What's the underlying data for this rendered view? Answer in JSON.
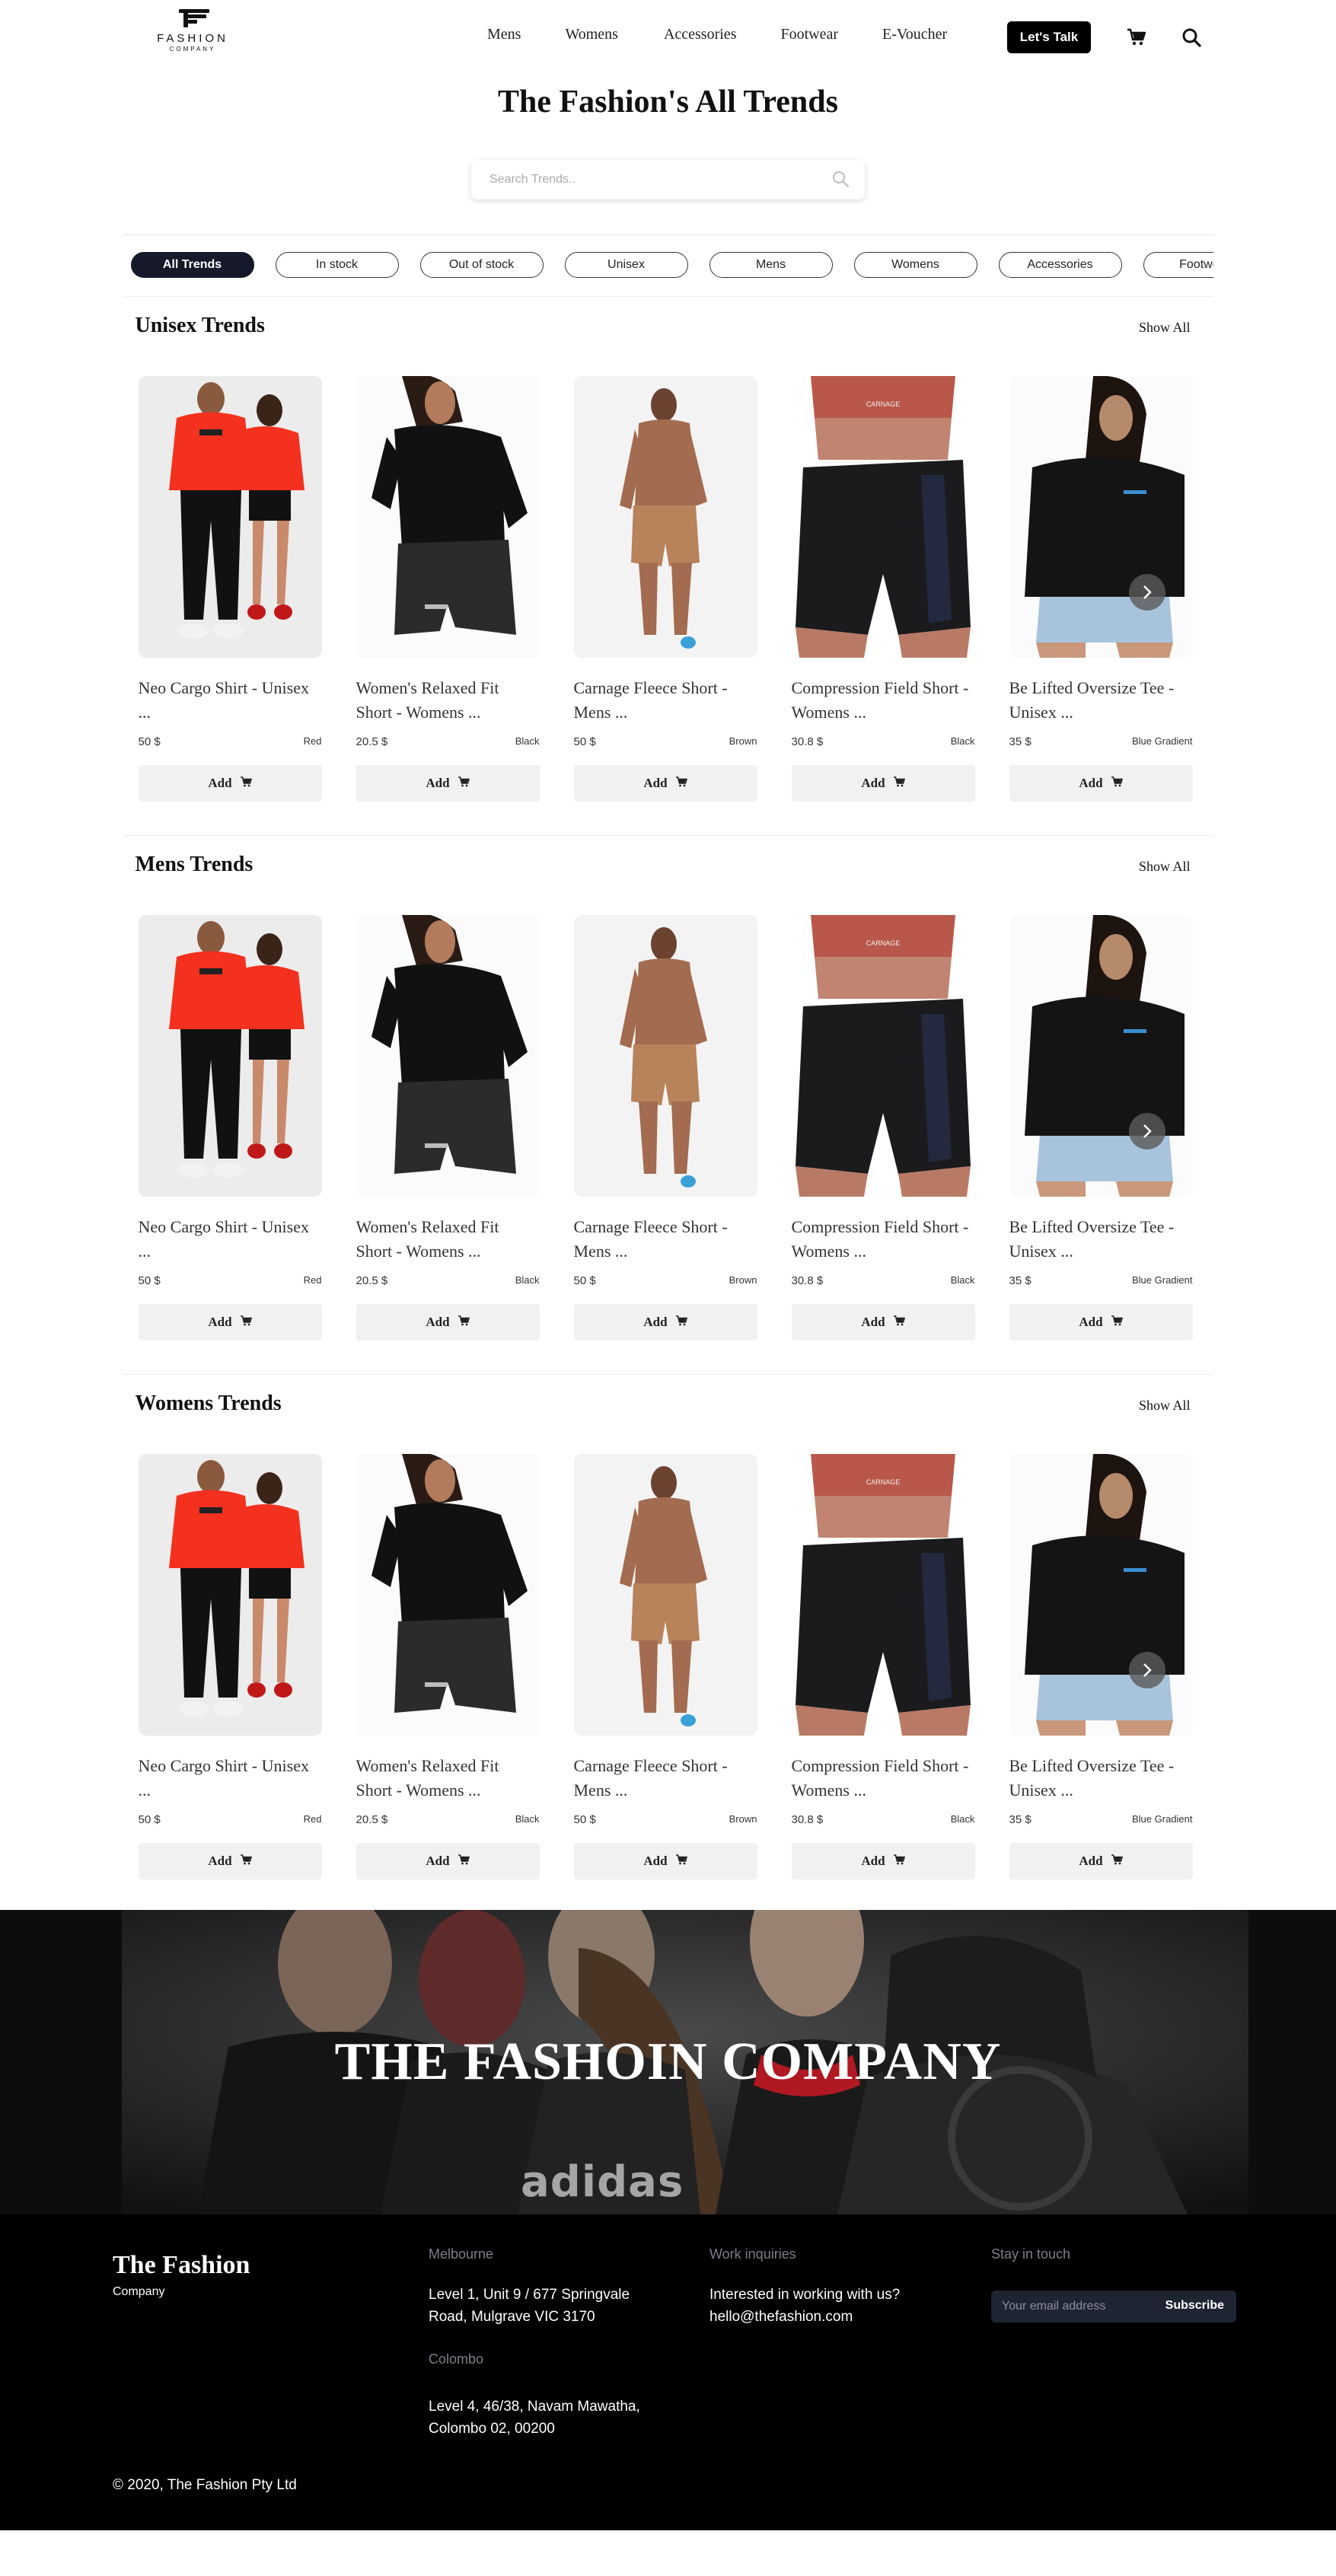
{
  "brand": {
    "logo_name": "FASHION",
    "logo_sub": "COMPANY"
  },
  "nav": [
    "Mens",
    "Womens",
    "Accessories",
    "Footwear",
    "E-Voucher"
  ],
  "header": {
    "cta": "Let's Talk",
    "cart_icon": "cart-icon",
    "search_icon": "search-icon"
  },
  "page_title": "The Fashion's All Trends",
  "search": {
    "placeholder": "Search Trends.."
  },
  "filters": [
    "All Trends",
    "In stock",
    "Out of stock",
    "Unisex",
    "Mens",
    "Womens",
    "Accessories",
    "Footwear"
  ],
  "active_filter": "All Trends",
  "sections": [
    {
      "title": "Unisex Trends",
      "show_all": "Show All"
    },
    {
      "title": "Mens Trends",
      "show_all": "Show All"
    },
    {
      "title": "Womens Trends",
      "show_all": "Show All"
    }
  ],
  "products": [
    {
      "name": "Neo Cargo Shirt - Unisex ...",
      "price": "50 $",
      "color": "Red"
    },
    {
      "name": "Women's Relaxed Fit Short - Womens ...",
      "price": "20.5 $",
      "color": "Black"
    },
    {
      "name": "Carnage Fleece Short - Mens ...",
      "price": "50 $",
      "color": "Brown"
    },
    {
      "name": "Compression Field Short - Womens ...",
      "price": "30.8 $",
      "color": "Black"
    },
    {
      "name": "Be Lifted Oversize Tee - Unisex ...",
      "price": "35 $",
      "color": "Blue Gradient"
    }
  ],
  "add_label": "Add",
  "banner": {
    "title": "THE FASHOIN COMPANY",
    "watermark": "adidas"
  },
  "footer": {
    "brand": "The Fashion",
    "brand_sub": "Company",
    "melbourne_label": "Melbourne",
    "melbourne_address": "Level 1, Unit 9 / 677 Springvale Road, Mulgrave VIC 3170",
    "colombo_label": "Colombo",
    "colombo_address": "Level 4, 46/38, Navam Mawatha, Colombo 02, 00200",
    "work_label": "Work inquiries",
    "work_text": "Interested in working with us?",
    "work_email": "hello@thefashion.com",
    "stay_label": "Stay in touch",
    "email_placeholder": "Your email address",
    "subscribe": "Subscribe",
    "copyright": "© 2020, The Fashion Pty Ltd"
  }
}
